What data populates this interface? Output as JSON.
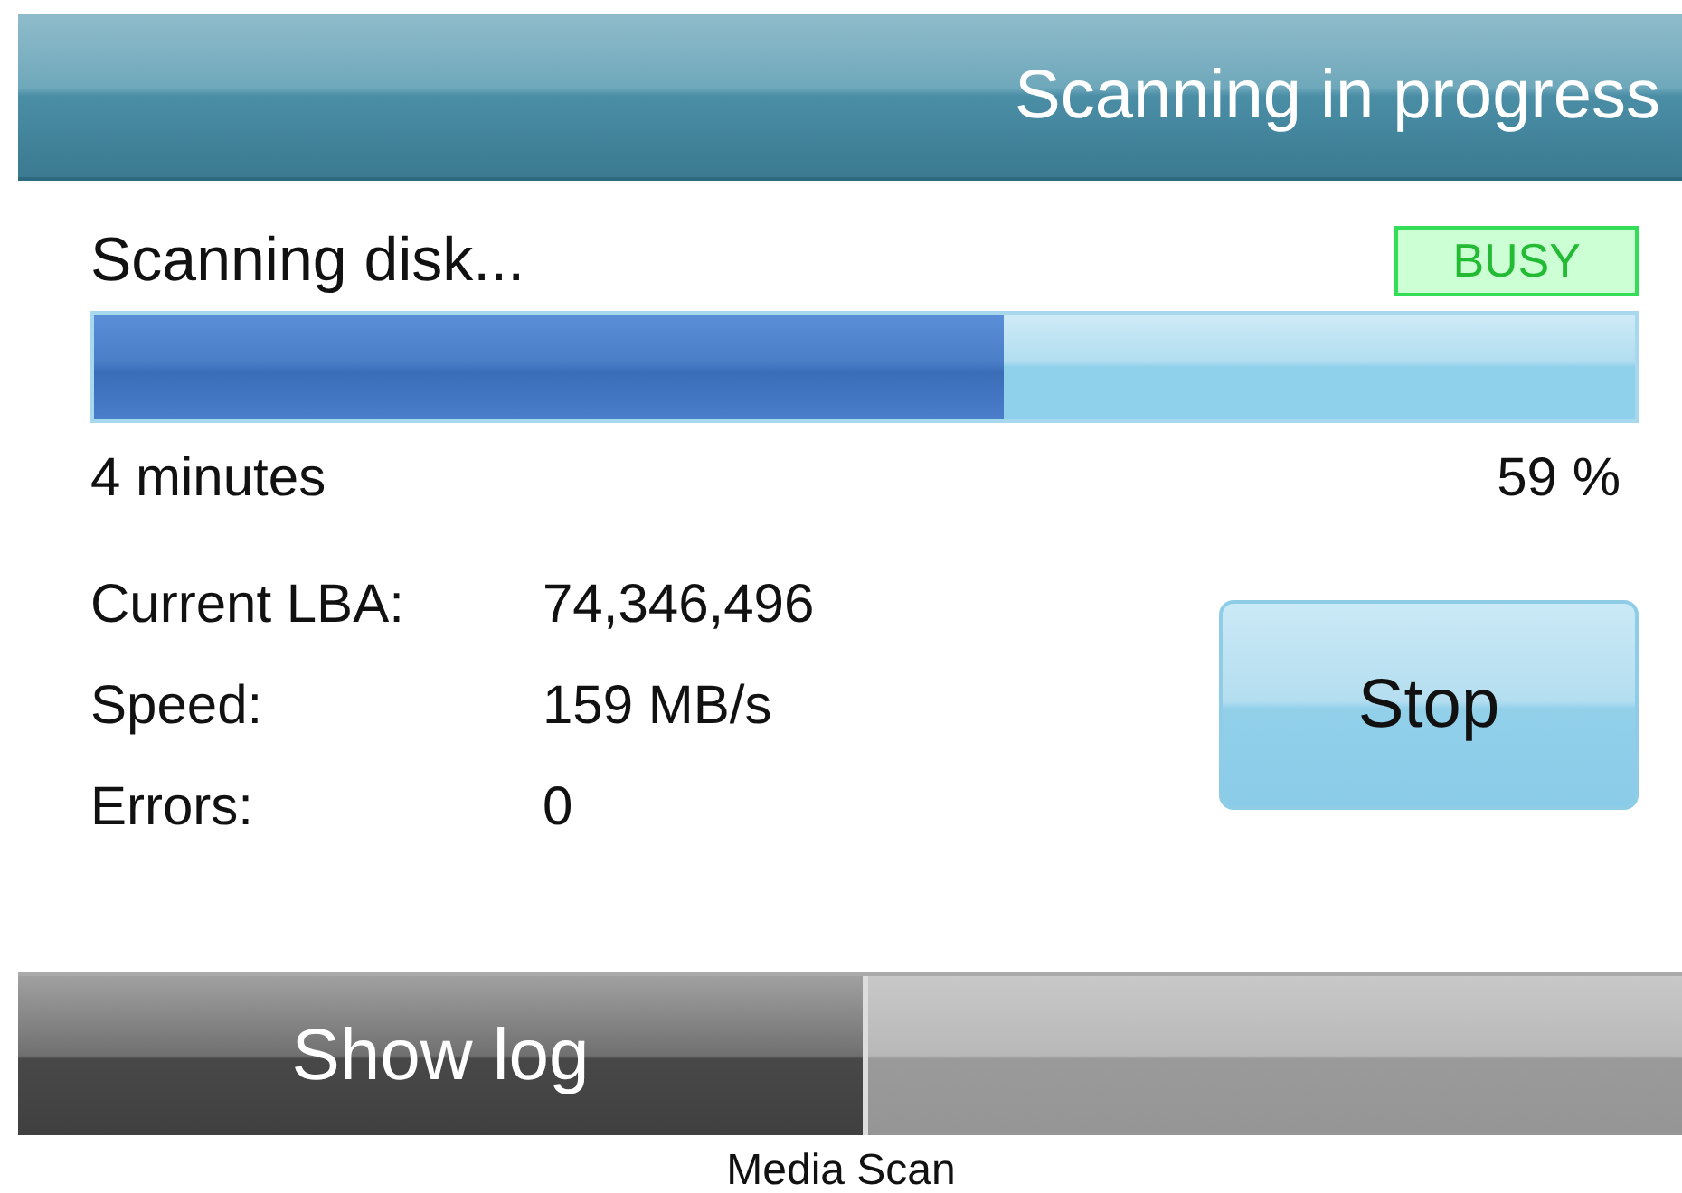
{
  "header": {
    "title": "Scanning in progress"
  },
  "status": {
    "label": "Scanning disk...",
    "badge": "BUSY"
  },
  "progress": {
    "level": 0.59,
    "time_left": "4 minutes",
    "percent": "59 %"
  },
  "stats": [
    {
      "label": "Current LBA:",
      "value": "74,346,496"
    },
    {
      "label": "Speed:",
      "value": "159 MB/s"
    },
    {
      "label": "Errors:",
      "value": "0"
    }
  ],
  "stop_button": {
    "label": "Stop"
  },
  "bottom_bar": {
    "buttons": [
      {
        "label": "Show log",
        "kind": "dark"
      },
      {
        "kind": "light"
      }
    ]
  },
  "caption": "Media Scan"
}
